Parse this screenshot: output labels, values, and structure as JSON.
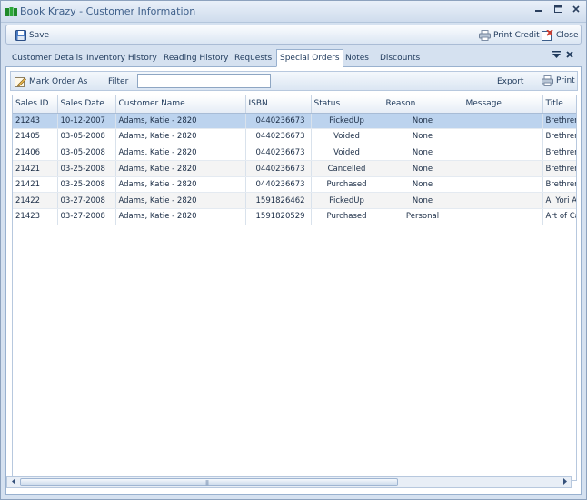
{
  "window": {
    "title": "Book Krazy - Customer Information"
  },
  "toolbar": {
    "save_label": "Save",
    "print_credit_label": "Print Credit",
    "close_label": "Close"
  },
  "tabs": [
    {
      "label": "Customer Details"
    },
    {
      "label": "Inventory  History"
    },
    {
      "label": "Reading History"
    },
    {
      "label": "Requests"
    },
    {
      "label": "Special Orders",
      "active": true
    },
    {
      "label": "Notes"
    },
    {
      "label": "Discounts"
    }
  ],
  "subbar": {
    "mark_order_label": "Mark Order As",
    "filter_label": "Filter",
    "filter_value": "",
    "export_label": "Export",
    "print_label": "Print"
  },
  "grid": {
    "columns": [
      "Sales ID",
      "Sales Date",
      "Customer Name",
      "ISBN",
      "Status",
      "Reason",
      "Message",
      "Title"
    ],
    "rows": [
      [
        "21243",
        "10-12-2007",
        "Adams, Katie - 2820",
        "0440236673",
        "PickedUp",
        "None",
        "",
        "Brethren"
      ],
      [
        "21405",
        "03-05-2008",
        "Adams, Katie - 2820",
        "0440236673",
        "Voided",
        "None",
        "",
        "Brethren"
      ],
      [
        "21406",
        "03-05-2008",
        "Adams, Katie - 2820",
        "0440236673",
        "Voided",
        "None",
        "",
        "Brethren"
      ],
      [
        "21421",
        "03-25-2008",
        "Adams, Katie - 2820",
        "0440236673",
        "Cancelled",
        "None",
        "",
        "Brethren"
      ],
      [
        "21421",
        "03-25-2008",
        "Adams, Katie - 2820",
        "0440236673",
        "Purchased",
        "None",
        "",
        "Brethren"
      ],
      [
        "21422",
        "03-27-2008",
        "Adams, Katie - 2820",
        "1591826462",
        "PickedUp",
        "None",
        "",
        "Ai Yori Ao"
      ],
      [
        "21423",
        "03-27-2008",
        "Adams, Katie - 2820",
        "1591820529",
        "Purchased",
        "Personal",
        "",
        "Art of Ca"
      ]
    ]
  },
  "colors": {
    "accent": "#1e395b",
    "selection": "#bcd3ee",
    "app_icon": "#1f8a2a"
  }
}
